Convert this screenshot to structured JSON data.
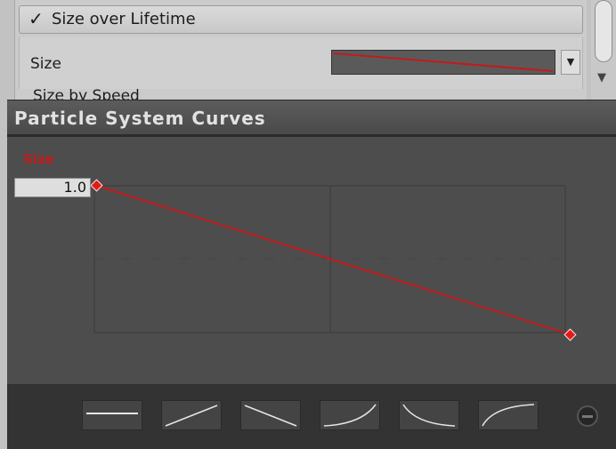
{
  "inspector": {
    "module_checkbox": "✓",
    "module_title": "Size over Lifetime",
    "size_row_label": "Size",
    "dropdown_arrow": "▼",
    "next_row_label": "Size by Speed"
  },
  "curves_window": {
    "title": "Particle System Curves",
    "curve_label": "Size",
    "value_field": "1.0",
    "curve": {
      "start": 1.0,
      "end": 0.0,
      "color": "#c41a1a"
    },
    "presets": [
      {
        "name": "constant",
        "icon": "flat-line-icon"
      },
      {
        "name": "linear-up",
        "icon": "ramp-up-icon"
      },
      {
        "name": "linear-down",
        "icon": "ramp-down-icon"
      },
      {
        "name": "ease-in",
        "icon": "ease-in-icon"
      },
      {
        "name": "ease-out-down",
        "icon": "ease-out-down-icon"
      },
      {
        "name": "ease-out-up",
        "icon": "ease-out-up-icon"
      }
    ],
    "remove_icon": "remove-icon"
  }
}
